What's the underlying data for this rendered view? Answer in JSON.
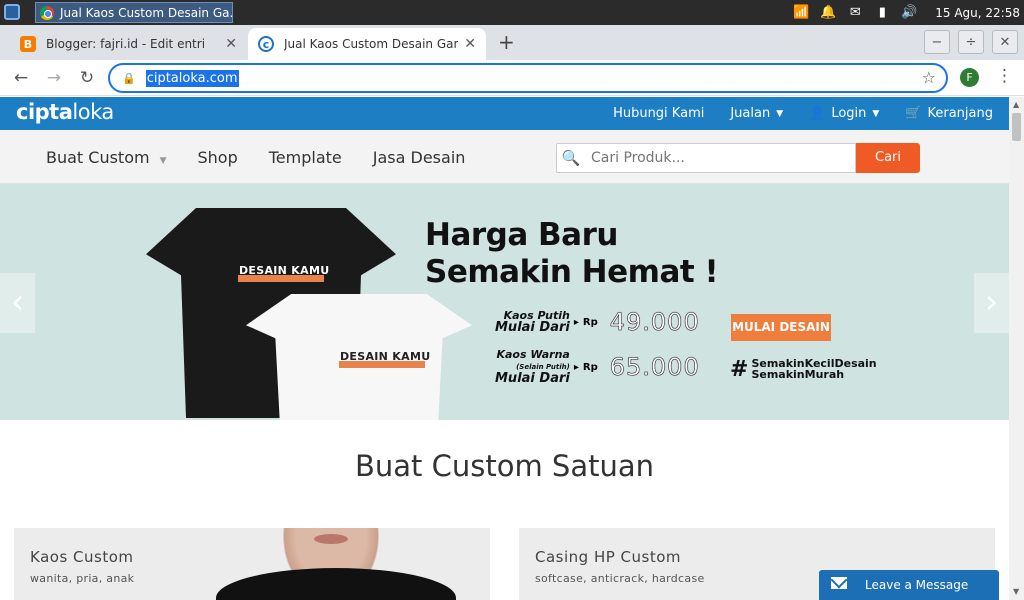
{
  "os": {
    "task_title": "Jual Kaos Custom Desain Ga...",
    "clock": "15 Agu, 22:58"
  },
  "browser": {
    "tabs": [
      {
        "title": "Blogger: fajri.id - Edit entri",
        "favicon": "blogger-icon",
        "active": false
      },
      {
        "title": "Jual Kaos Custom Desain Gamb",
        "favicon": "ciptaloka-icon",
        "active": true
      }
    ],
    "url": "ciptaloka.com",
    "profile_initial": "F"
  },
  "site": {
    "logo_bold": "cipta",
    "logo_thin": "loka",
    "top_nav": [
      "Hubungi Kami",
      "Jualan",
      "Login",
      "Keranjang"
    ],
    "main_nav": [
      "Buat Custom",
      "Shop",
      "Template",
      "Jasa Desain"
    ],
    "search_placeholder": "Cari Produk...",
    "search_button": "Cari"
  },
  "banner": {
    "headline_1": "Harga Baru",
    "headline_2": "Semakin Hemat !",
    "tee_label": "DESAIN KAMU",
    "price_1_label_1": "Kaos Putih",
    "price_1_label_2": "Mulai Dari",
    "price_1_currency": "Rp",
    "price_1_value": "49.000",
    "price_2_label_1": "Kaos Warna",
    "price_2_note": "(Selain Putih)",
    "price_2_label_2": "Mulai Dari",
    "price_2_currency": "Rp",
    "price_2_value": "65.000",
    "cta": "MULAI DESAIN",
    "hashtag_1": "SemakinKecilDesain",
    "hashtag_2": "SemakinMurah",
    "colors": {
      "cta": "#ef7d3c",
      "background": "#cfe3e0"
    }
  },
  "section": {
    "title": "Buat Custom Satuan",
    "cards": [
      {
        "title": "Kaos Custom",
        "subtitle": "wanita, pria, anak"
      },
      {
        "title": "Casing HP Custom",
        "subtitle": "softcase, anticrack, hardcase"
      }
    ]
  },
  "chat": {
    "label": "Leave a Message"
  },
  "colors": {
    "brand_blue": "#1d7ec4",
    "search_button": "#f05a24"
  }
}
